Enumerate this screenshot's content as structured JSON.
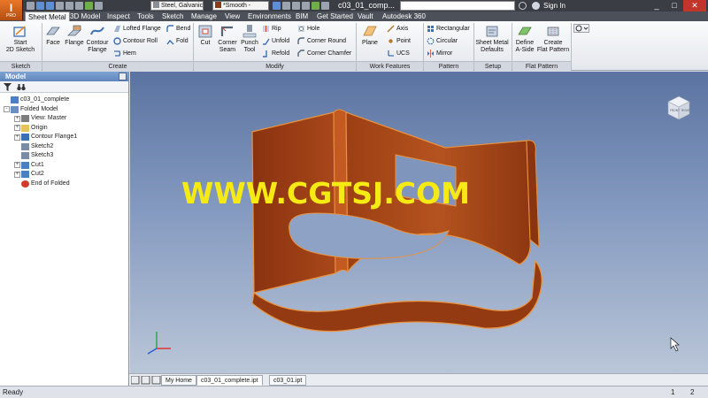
{
  "app": {
    "logo_letter": "I",
    "edition": "PRO"
  },
  "qat": {
    "material": "Steel, Galvanic",
    "appearance": "*Smooth -",
    "document_title": "c03_01_comp...",
    "search_placeholder": "",
    "sign_in": "Sign In",
    "colors": {
      "title_bg": "#3a3d43",
      "app_button": "#d9631d",
      "material_swatch": "#8a8f94",
      "appearance_swatch": "#8a3a12"
    }
  },
  "tabs": [
    "Sheet Metal",
    "3D Model",
    "Inspect",
    "Tools",
    "Sketch",
    "Manage",
    "View",
    "Environments",
    "BIM",
    "Get Started",
    "Vault",
    "Autodesk 360"
  ],
  "ribbon": {
    "sketch": {
      "start_line1": "Start",
      "start_line2": "2D Sketch",
      "group": "Sketch"
    },
    "create": {
      "face": "Face",
      "flange": "Flange",
      "contour_line1": "Contour",
      "contour_line2": "Flange",
      "lofted_flange": "Lofted Flange",
      "contour_roll": "Contour Roll",
      "hem": "Hem",
      "bend": "Bend",
      "fold": "Fold",
      "group": "Create"
    },
    "modify": {
      "cut": "Cut",
      "corner_seam_line1": "Corner",
      "corner_seam_line2": "Seam",
      "punch_line1": "Punch",
      "punch_line2": "Tool",
      "rip": "Rip",
      "unfold": "Unfold",
      "refold": "Refold",
      "hole": "Hole",
      "corner_round": "Corner Round",
      "corner_chamfer": "Corner Chamfer",
      "group": "Modify"
    },
    "work_features": {
      "plane": "Plane",
      "axis": "Axis",
      "point": "Point",
      "ucs": "UCS",
      "group": "Work Features"
    },
    "pattern": {
      "rectangular": "Rectangular",
      "circular": "Circular",
      "mirror": "Mirror",
      "group": "Pattern"
    },
    "setup": {
      "defaults_line1": "Sheet Metal",
      "defaults_line2": "Defaults",
      "group": "Setup"
    },
    "flat_pattern": {
      "define_line1": "Define",
      "define_line2": "A-Side",
      "create_line1": "Create",
      "create_line2": "Flat Pattern",
      "group": "Flat Pattern"
    }
  },
  "browser": {
    "title": "Model",
    "tree": [
      {
        "label": "c03_01_complete",
        "expander": "",
        "icon": "part-icon",
        "level": 0
      },
      {
        "label": "Folded Model",
        "expander": "-",
        "icon": "folded-model-icon",
        "level": 0
      },
      {
        "label": "View: Master",
        "expander": "+",
        "icon": "view-icon",
        "level": 1
      },
      {
        "label": "Origin",
        "expander": "+",
        "icon": "folder-icon",
        "level": 1
      },
      {
        "label": "Contour Flange1",
        "expander": "+",
        "icon": "contour-flange-icon",
        "level": 1
      },
      {
        "label": "Sketch2",
        "expander": "",
        "icon": "sketch-icon",
        "level": 1
      },
      {
        "label": "Sketch3",
        "expander": "",
        "icon": "sketch-icon",
        "level": 1
      },
      {
        "label": "Cut1",
        "expander": "+",
        "icon": "cut-icon",
        "level": 1
      },
      {
        "label": "Cut2",
        "expander": "+",
        "icon": "cut-icon",
        "level": 1
      },
      {
        "label": "End of Folded",
        "expander": "",
        "icon": "end-of-part-icon",
        "level": 1
      }
    ]
  },
  "viewport": {
    "watermark": "WWW.CGTSJ.COM",
    "viewcube": {
      "front": "FRONT",
      "right": "RIGHT"
    },
    "colors": {
      "part_face": "#9a3d12",
      "part_edge": "#e08a3a",
      "background_top": "#5b73a1",
      "background_bottom": "#bac6d8",
      "watermark": "#f5ea14"
    }
  },
  "doc_tabs": [
    "My Home",
    "c03_01_complete.ipt",
    "c03_01.ipt"
  ],
  "status": {
    "text": "Ready",
    "count1": "1",
    "count2": "2"
  }
}
